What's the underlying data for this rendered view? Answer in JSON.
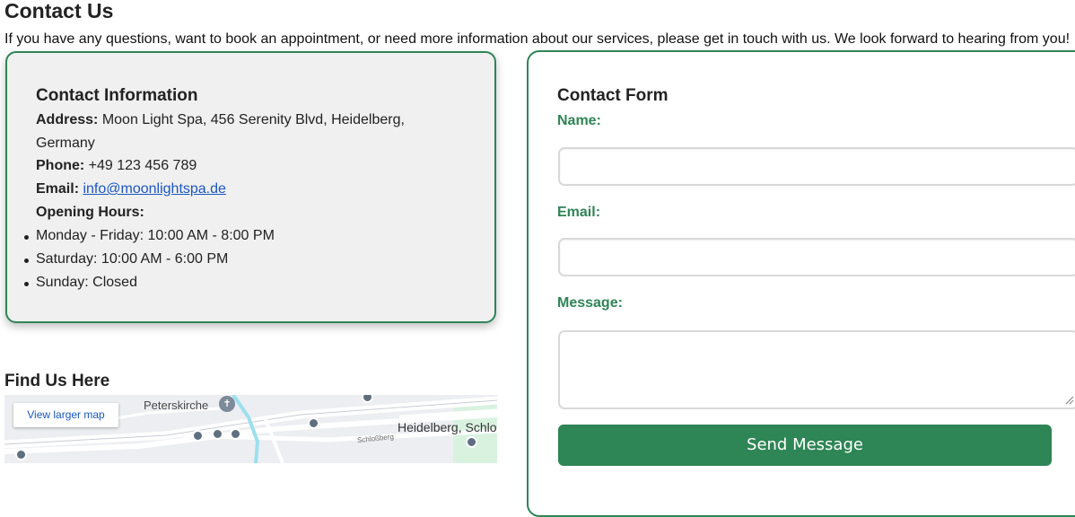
{
  "page": {
    "title": "Contact Us",
    "intro": "If you have any questions, want to book an appointment, or need more information about our services, please get in touch with us. We look forward to hearing from you!"
  },
  "contact_info": {
    "heading": "Contact Information",
    "address_label": "Address:",
    "address_line1": "Moon Light Spa, 456 Serenity Blvd, Heidelberg,",
    "address_line2": "Germany",
    "phone_label": "Phone:",
    "phone": "+49 123 456 789",
    "email_label": "Email:",
    "email": "info@moonlightspa.de",
    "hours_label": "Opening Hours:",
    "hours": [
      "Monday - Friday: 10:00 AM - 8:00 PM",
      "Saturday: 10:00 AM - 6:00 PM",
      "Sunday: Closed"
    ]
  },
  "map_section": {
    "heading": "Find Us Here",
    "view_larger": "View larger map",
    "label_church": "Peterskirche",
    "label_castle": "Heidelberg, Schlo",
    "label_street": "Schloßberg"
  },
  "form": {
    "heading": "Contact Form",
    "name_label": "Name:",
    "email_label": "Email:",
    "message_label": "Message:",
    "submit_label": "Send Message",
    "name_value": "",
    "email_value": "",
    "message_value": ""
  },
  "colors": {
    "accent": "#2e8555",
    "link": "#1a56c4",
    "card_bg": "#f0f0f0"
  }
}
